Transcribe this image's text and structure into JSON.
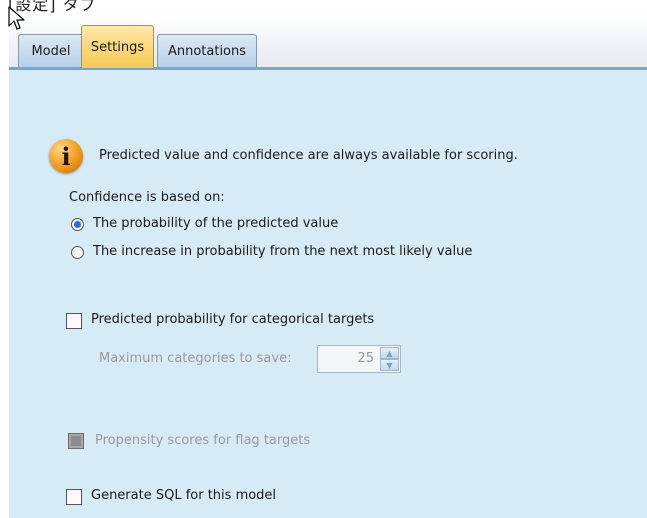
{
  "window": {
    "caption": "[設定] タブ"
  },
  "tabs": [
    {
      "label": "Model",
      "active": false
    },
    {
      "label": "Settings",
      "active": true
    },
    {
      "label": "Annotations",
      "active": false
    }
  ],
  "info": {
    "icon": "info-icon",
    "message": "Predicted value and confidence are always available for scoring."
  },
  "confidence": {
    "label": "Confidence is based on:",
    "options": [
      {
        "label": "The probability of the predicted value",
        "selected": true
      },
      {
        "label": "The increase in probability from the next most likely value",
        "selected": false
      }
    ]
  },
  "predicted_probability": {
    "label": "Predicted probability for categorical targets",
    "checked": false
  },
  "max_categories": {
    "label": "Maximum categories to save:",
    "value": "25",
    "enabled": false
  },
  "propensity": {
    "label": "Propensity scores for flag targets",
    "checked": false,
    "enabled": false
  },
  "generate_sql": {
    "label": "Generate SQL for this model",
    "checked": false
  },
  "colors": {
    "panel_bg": "#d7ebf7",
    "active_tab": "#f6c956",
    "radio_selected": "#2f6fd0",
    "info_icon": "#f39a1d"
  }
}
